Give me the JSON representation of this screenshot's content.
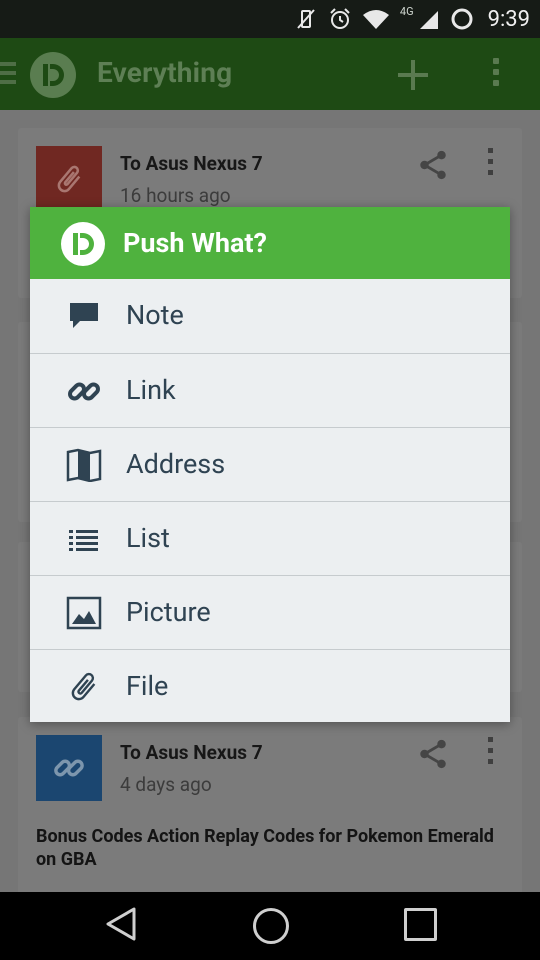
{
  "status_bar": {
    "network": "4G",
    "time": "9:39"
  },
  "app_bar": {
    "title": "Everything"
  },
  "cards": [
    {
      "target": "To Asus Nexus 7",
      "time": "16 hours ago",
      "thumb_color": "#a1342c",
      "thumb_icon": "paperclip-icon"
    },
    {
      "target": "To Asus Nexus 7",
      "time": "4 days ago",
      "thumb_color": "#1f5d99",
      "thumb_icon": "link-icon",
      "body": "Bonus Codes Action Replay Codes for Pokemon Emerald on GBA"
    }
  ],
  "dialog": {
    "title": "Push What?",
    "header_color": "#4fb23e",
    "options": [
      {
        "label": "Note",
        "icon": "note-icon"
      },
      {
        "label": "Link",
        "icon": "link-icon"
      },
      {
        "label": "Address",
        "icon": "map-icon"
      },
      {
        "label": "List",
        "icon": "list-icon"
      },
      {
        "label": "Picture",
        "icon": "picture-icon"
      },
      {
        "label": "File",
        "icon": "paperclip-icon"
      }
    ]
  }
}
